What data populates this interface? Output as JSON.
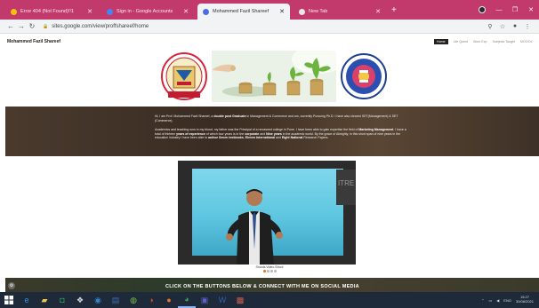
{
  "browser": {
    "tabs": [
      {
        "title": "Error 404 (Not Found)!!1",
        "favicon_color": "#f4c20d",
        "active": false
      },
      {
        "title": "Sign in - Google Accounts",
        "favicon_color": "#4285f4",
        "active": false
      },
      {
        "title": "Mohammed Fazil Shareef",
        "favicon_color": "#4a6de5",
        "active": true
      },
      {
        "title": "New Tab",
        "favicon_color": "#e8e8e8",
        "active": false
      }
    ],
    "new_tab_label": "+",
    "address": "sites.google.com/view/proffshareef/home"
  },
  "site": {
    "title": "Mohammed Fazil Shareef",
    "nav": [
      "Home",
      "Life Quest",
      "Work Exp",
      "Subjects Taught",
      "MOOCs"
    ]
  },
  "intro": {
    "p1": [
      {
        "t": "Hi, I am Prof. Mohammed Fazil Shareef, a ",
        "b": false
      },
      {
        "t": "double post Graduate",
        "b": true
      },
      {
        "t": " in Management & Commerce and am, currently Pursuing Ph.D. I have also cleared SET(Management) & SET (Commerce).",
        "b": false
      }
    ],
    "p2": [
      {
        "t": "Academics and teaching runs in my blood, my father was the Principal of a renowned college in Pune.  I have been able to gain expertise the field of ",
        "b": false
      },
      {
        "t": "Marketing Management",
        "b": true
      },
      {
        "t": ". I have a total of thirteen ",
        "b": false
      },
      {
        "t": "years of experience",
        "b": true
      },
      {
        "t": " of which four years is in the ",
        "b": false
      },
      {
        "t": "corporate",
        "b": true
      },
      {
        "t": " and ",
        "b": false
      },
      {
        "t": "Nine years",
        "b": true
      },
      {
        "t": " in the academic world. By the grace of Almighty, in this short span of nine years in the education industry I have been able to ",
        "b": false
      },
      {
        "t": "author Seven textbooks",
        "b": true
      },
      {
        "t": ", ",
        "b": false
      },
      {
        "t": "Eleven International",
        "b": true
      },
      {
        "t": " and ",
        "b": false
      },
      {
        "t": "Eight National",
        "b": true
      },
      {
        "t": " Research Papers.",
        "b": false
      }
    ]
  },
  "slideshow": {
    "caption": "Shoots Video Shoot",
    "slide_count": 4,
    "current": 1
  },
  "cta": "CLICK ON THE BUTTONS BELOW & CONNECT WITH ME ON SOCIAL MEDIA",
  "taskbar": {
    "apps": [
      {
        "icon": "ie-icon",
        "glyph": "e",
        "color": "#3b8fe0",
        "active": false
      },
      {
        "icon": "file-explorer-icon",
        "glyph": "▰",
        "color": "#f2c744",
        "active": false
      },
      {
        "icon": "store-icon",
        "glyph": "◘",
        "color": "#2a9a52",
        "active": false
      },
      {
        "icon": "app-icon",
        "glyph": "❖",
        "color": "#dddddd",
        "active": false
      },
      {
        "icon": "app-icon",
        "glyph": "◉",
        "color": "#2f86c9",
        "active": false
      },
      {
        "icon": "app-icon",
        "glyph": "▤",
        "color": "#3c6fb5",
        "active": false
      },
      {
        "icon": "app-icon",
        "glyph": "◍",
        "color": "#77c043",
        "active": false
      },
      {
        "icon": "app-icon",
        "glyph": "◑",
        "color": "#d04a3a",
        "active": false
      },
      {
        "icon": "firefox-icon",
        "glyph": "●",
        "color": "#e8742b",
        "active": false
      },
      {
        "icon": "chrome-icon",
        "glyph": "◕",
        "color": "#3aa757",
        "active": true
      },
      {
        "icon": "teams-icon",
        "glyph": "▣",
        "color": "#5b5fc7",
        "active": false
      },
      {
        "icon": "word-icon",
        "glyph": "W",
        "color": "#2b5fb4",
        "active": false
      },
      {
        "icon": "app-icon",
        "glyph": "▩",
        "color": "#cc5f4a",
        "active": false
      }
    ],
    "tray": {
      "language": "ENG",
      "time": "15:27",
      "date": "30/08/2021"
    }
  },
  "colors": {
    "tabstrip": "#c23a6b",
    "taskbar": "#1e2a3a",
    "dot_active": "#e07a2c"
  }
}
